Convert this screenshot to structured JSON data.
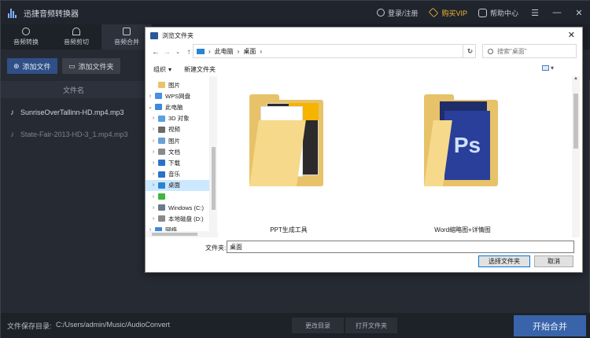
{
  "app": {
    "title": "迅捷音频转换器",
    "login": "登录/注册",
    "vip": "购买VIP",
    "help": "帮助中心",
    "window_controls": [
      "☰",
      "—",
      "✕"
    ]
  },
  "toolbar": [
    {
      "label": "音频转换",
      "icon": "refresh-icon"
    },
    {
      "label": "音频剪切",
      "icon": "scissors-icon"
    },
    {
      "label": "音频合并",
      "icon": "merge-icon",
      "active": true
    }
  ],
  "actions": {
    "add_file": "添加文件",
    "add_folder": "添加文件夹"
  },
  "file_list": {
    "header": "文件名",
    "rows": [
      {
        "name": "SunriseOverTallinn-HD.mp4.mp3",
        "dim": false
      },
      {
        "name": "State-Fair-2013-HD-3_1.mp4.mp3",
        "dim": true
      }
    ]
  },
  "bottom": {
    "save_label": "文件保存目录:",
    "save_path": "C:/Users/admin/Music/AudioConvert",
    "change_dir": "更改目录",
    "open_folder": "打开文件夹",
    "start": "开始合并"
  },
  "dialog": {
    "title": "浏览文件夹",
    "address": [
      "此电脑",
      "桌面"
    ],
    "search_placeholder": "搜索\"桌面\"",
    "organize": "组织",
    "new_folder": "新建文件夹",
    "tree": [
      {
        "label": "图片",
        "indent": 1,
        "chevron": "",
        "icon": "#e8c36a"
      },
      {
        "label": "WPS网盘",
        "indent": 0,
        "chevron": ">",
        "icon": "#4a90e2"
      },
      {
        "label": "此电脑",
        "indent": 0,
        "chevron": "v",
        "icon": "#3c8ad8"
      },
      {
        "label": "3D 对象",
        "indent": 1,
        "chevron": ">",
        "icon": "#5aa0e6"
      },
      {
        "label": "视频",
        "indent": 1,
        "chevron": ">",
        "icon": "#6b6b6b"
      },
      {
        "label": "图片",
        "indent": 1,
        "chevron": ">",
        "icon": "#6aa0d8"
      },
      {
        "label": "文档",
        "indent": 1,
        "chevron": ">",
        "icon": "#8a8a8a"
      },
      {
        "label": "下载",
        "indent": 1,
        "chevron": ">",
        "icon": "#2a72c8"
      },
      {
        "label": "音乐",
        "indent": 1,
        "chevron": ">",
        "icon": "#2a72c8"
      },
      {
        "label": "桌面",
        "indent": 1,
        "chevron": ">",
        "icon": "#2a84d2",
        "selected": true
      },
      {
        "label": "",
        "indent": 1,
        "chevron": ">",
        "icon": "#3fb53f"
      },
      {
        "label": "Windows (C:)",
        "indent": 1,
        "chevron": ">",
        "icon": "#6b7b8c"
      },
      {
        "label": "本地磁盘 (D:)",
        "indent": 1,
        "chevron": ">",
        "icon": "#8a8a8a"
      },
      {
        "label": "网络",
        "indent": 0,
        "chevron": ">",
        "icon": "#3c8ad8"
      }
    ],
    "folders": [
      {
        "label": "PPT生成工具"
      },
      {
        "label": "Word缩略图+详情图"
      }
    ],
    "filename_label": "文件夹:",
    "filename_value": "桌面",
    "ok": "选择文件夹",
    "cancel": "取消"
  }
}
